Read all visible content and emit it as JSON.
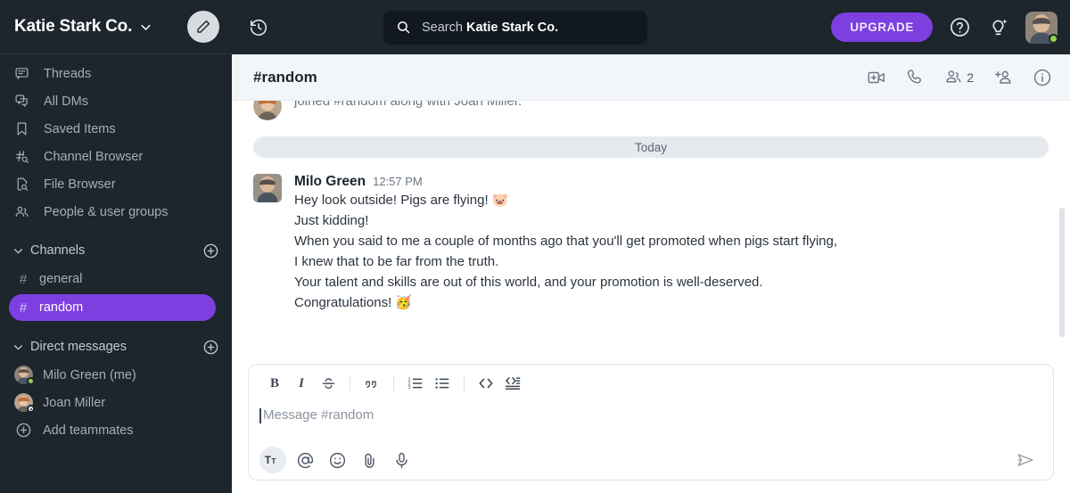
{
  "workspace": {
    "name": "Katie Stark Co.",
    "chevron_icon": "chevron-down-icon",
    "compose_icon": "pencil-icon"
  },
  "sidebar": {
    "nav_items": [
      {
        "label": "Threads",
        "icon": "threads-icon"
      },
      {
        "label": "All DMs",
        "icon": "all-dms-icon"
      },
      {
        "label": "Saved Items",
        "icon": "bookmark-icon"
      },
      {
        "label": "Channel Browser",
        "icon": "channel-search-icon"
      },
      {
        "label": "File Browser",
        "icon": "file-search-icon"
      },
      {
        "label": "People & user groups",
        "icon": "people-icon"
      }
    ],
    "channels_section": {
      "title": "Channels",
      "add_icon": "plus-circle-icon"
    },
    "channels": [
      {
        "name": "general",
        "active": false
      },
      {
        "name": "random",
        "active": true
      }
    ],
    "dms_section": {
      "title": "Direct messages",
      "add_icon": "plus-circle-icon"
    },
    "dms": [
      {
        "name": "Milo Green (me)",
        "presence": "online"
      },
      {
        "name": "Joan Miller",
        "presence": "away"
      }
    ],
    "add_teammates": {
      "label": "Add teammates",
      "icon": "plus-circle-icon"
    }
  },
  "topbar": {
    "history_icon": "history-clock-icon",
    "search": {
      "icon": "search-icon",
      "prefix": "Search",
      "scope": "Katie Stark Co."
    },
    "upgrade_label": "UPGRADE",
    "help_icon": "question-circle-icon",
    "whats_new_icon": "lightbulb-icon",
    "avatar": {
      "name": "Milo Green",
      "presence": "online"
    }
  },
  "channel": {
    "title": "#random",
    "actions": [
      {
        "icon": "video-add-icon",
        "label": ""
      },
      {
        "icon": "phone-icon",
        "label": ""
      },
      {
        "icon": "members-icon",
        "label": "2"
      },
      {
        "icon": "add-person-icon",
        "label": ""
      },
      {
        "icon": "info-circle-icon",
        "label": ""
      }
    ]
  },
  "messages": {
    "join_notice": "joined #random along with Joan Miller.",
    "date_divider": "Today",
    "message": {
      "author": "Milo Green",
      "time": "12:57 PM",
      "lines": [
        "Hey look outside! Pigs are flying! 🐷",
        "Just kidding!",
        "When you said to me a couple of months ago that you'll get promoted when pigs start flying,",
        "I knew that to be far from the truth.",
        "Your talent and skills are out of this world, and your promotion is well-deserved.",
        "Congratulations! 🥳"
      ]
    }
  },
  "composer": {
    "format_buttons": [
      {
        "icon": "bold-icon",
        "label": "B"
      },
      {
        "icon": "italic-icon",
        "label": "I"
      },
      {
        "icon": "strikethrough-icon",
        "label": "S"
      },
      {
        "icon": "blockquote-icon",
        "label": ""
      },
      {
        "icon": "ordered-list-icon",
        "label": ""
      },
      {
        "icon": "bullet-list-icon",
        "label": ""
      },
      {
        "icon": "inline-code-icon",
        "label": ""
      },
      {
        "icon": "code-block-icon",
        "label": ""
      }
    ],
    "input_placeholder": "Message #random",
    "input_value": "",
    "action_buttons": [
      {
        "icon": "text-format-icon",
        "selected": true
      },
      {
        "icon": "mention-icon",
        "selected": false
      },
      {
        "icon": "emoji-icon",
        "selected": false
      },
      {
        "icon": "attachment-icon",
        "selected": false
      },
      {
        "icon": "microphone-icon",
        "selected": false
      }
    ],
    "send_icon": "send-icon"
  },
  "colors": {
    "sidebar_bg": "#1d252d",
    "accent_purple": "#7d3fe0",
    "header_bg": "#f3f6f9",
    "online_green": "#8ed44a"
  }
}
